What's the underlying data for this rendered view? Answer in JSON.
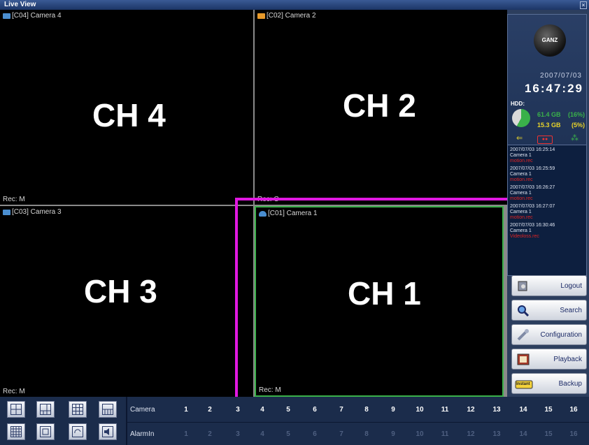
{
  "window": {
    "title": "Live View"
  },
  "channels": [
    {
      "caption": "[C04] Camera 4",
      "label": "CH 4",
      "rec": "Rec: M",
      "icon": "camera-icon",
      "icon_color": "#4a8ed0"
    },
    {
      "caption": "[C02] Camera 2",
      "label": "CH 2",
      "rec": "Rec: C",
      "icon": "camera-icon",
      "icon_color": "#e89a2a"
    },
    {
      "caption": "[C03] Camera 3",
      "label": "CH 3",
      "rec": "Rec: M",
      "icon": "camera-icon",
      "icon_color": "#4a8ed0"
    },
    {
      "caption": "[C01] Camera 1",
      "label": "CH 1",
      "rec": "Rec: M",
      "icon": "dome-camera-icon",
      "icon_color": "#4a8ed0"
    }
  ],
  "selected_channel": "CH 1",
  "colors": {
    "selection": "#e018e0",
    "active_border": "#3ab14a",
    "motion_text": "#e02222"
  },
  "sidebar": {
    "logo": "GANZ",
    "date": "2007/07/03",
    "time": "16:47:29",
    "hdd_label": "HDD:",
    "hdd": [
      {
        "size": "61.4 GB",
        "percent": "(16%)"
      },
      {
        "size": "15.3 GB",
        "percent": "(5%)"
      }
    ],
    "status_icons": [
      "usb-icon",
      "recording-icon",
      "network-icon"
    ],
    "events": [
      {
        "time": "2007/07/03 16:25:14",
        "camera": "Camera 1",
        "type": "motion.rec"
      },
      {
        "time": "2007/07/03 16:25:59",
        "camera": "Camera 1",
        "type": "motion.rec"
      },
      {
        "time": "2007/07/03 16:26:27",
        "camera": "Camera 1",
        "type": "motion.rec"
      },
      {
        "time": "2007/07/03 16:27:07",
        "camera": "Camera 1",
        "type": "motion.rec"
      },
      {
        "time": "2007/07/03 16:30:46",
        "camera": "Camera 1",
        "type": "Videoloss.rec"
      }
    ],
    "buttons": [
      {
        "label": "Logout",
        "icon": "logout-icon"
      },
      {
        "label": "Search",
        "icon": "search-icon"
      },
      {
        "label": "Configuration",
        "icon": "configuration-icon"
      },
      {
        "label": "Playback",
        "icon": "playback-icon"
      },
      {
        "label": "Backup",
        "icon": "backup-icon",
        "icon_text": "Instant"
      }
    ]
  },
  "bottom": {
    "layouts": [
      "layout-quad-icon",
      "layout-6-icon",
      "layout-9-icon",
      "layout-10-icon",
      "layout-16-icon",
      "layout-pip-icon",
      "layout-sequence-icon",
      "layout-audio-icon"
    ],
    "camera_label": "Camera",
    "alarm_label": "AlarmIn",
    "camera_numbers": [
      "1",
      "2",
      "3",
      "4",
      "5",
      "6",
      "7",
      "8",
      "9",
      "10",
      "11",
      "12",
      "13",
      "14",
      "15",
      "16"
    ],
    "alarm_numbers": [
      "1",
      "2",
      "3",
      "4",
      "5",
      "6",
      "7",
      "8",
      "9",
      "10",
      "11",
      "12",
      "13",
      "14",
      "15",
      "16"
    ]
  }
}
